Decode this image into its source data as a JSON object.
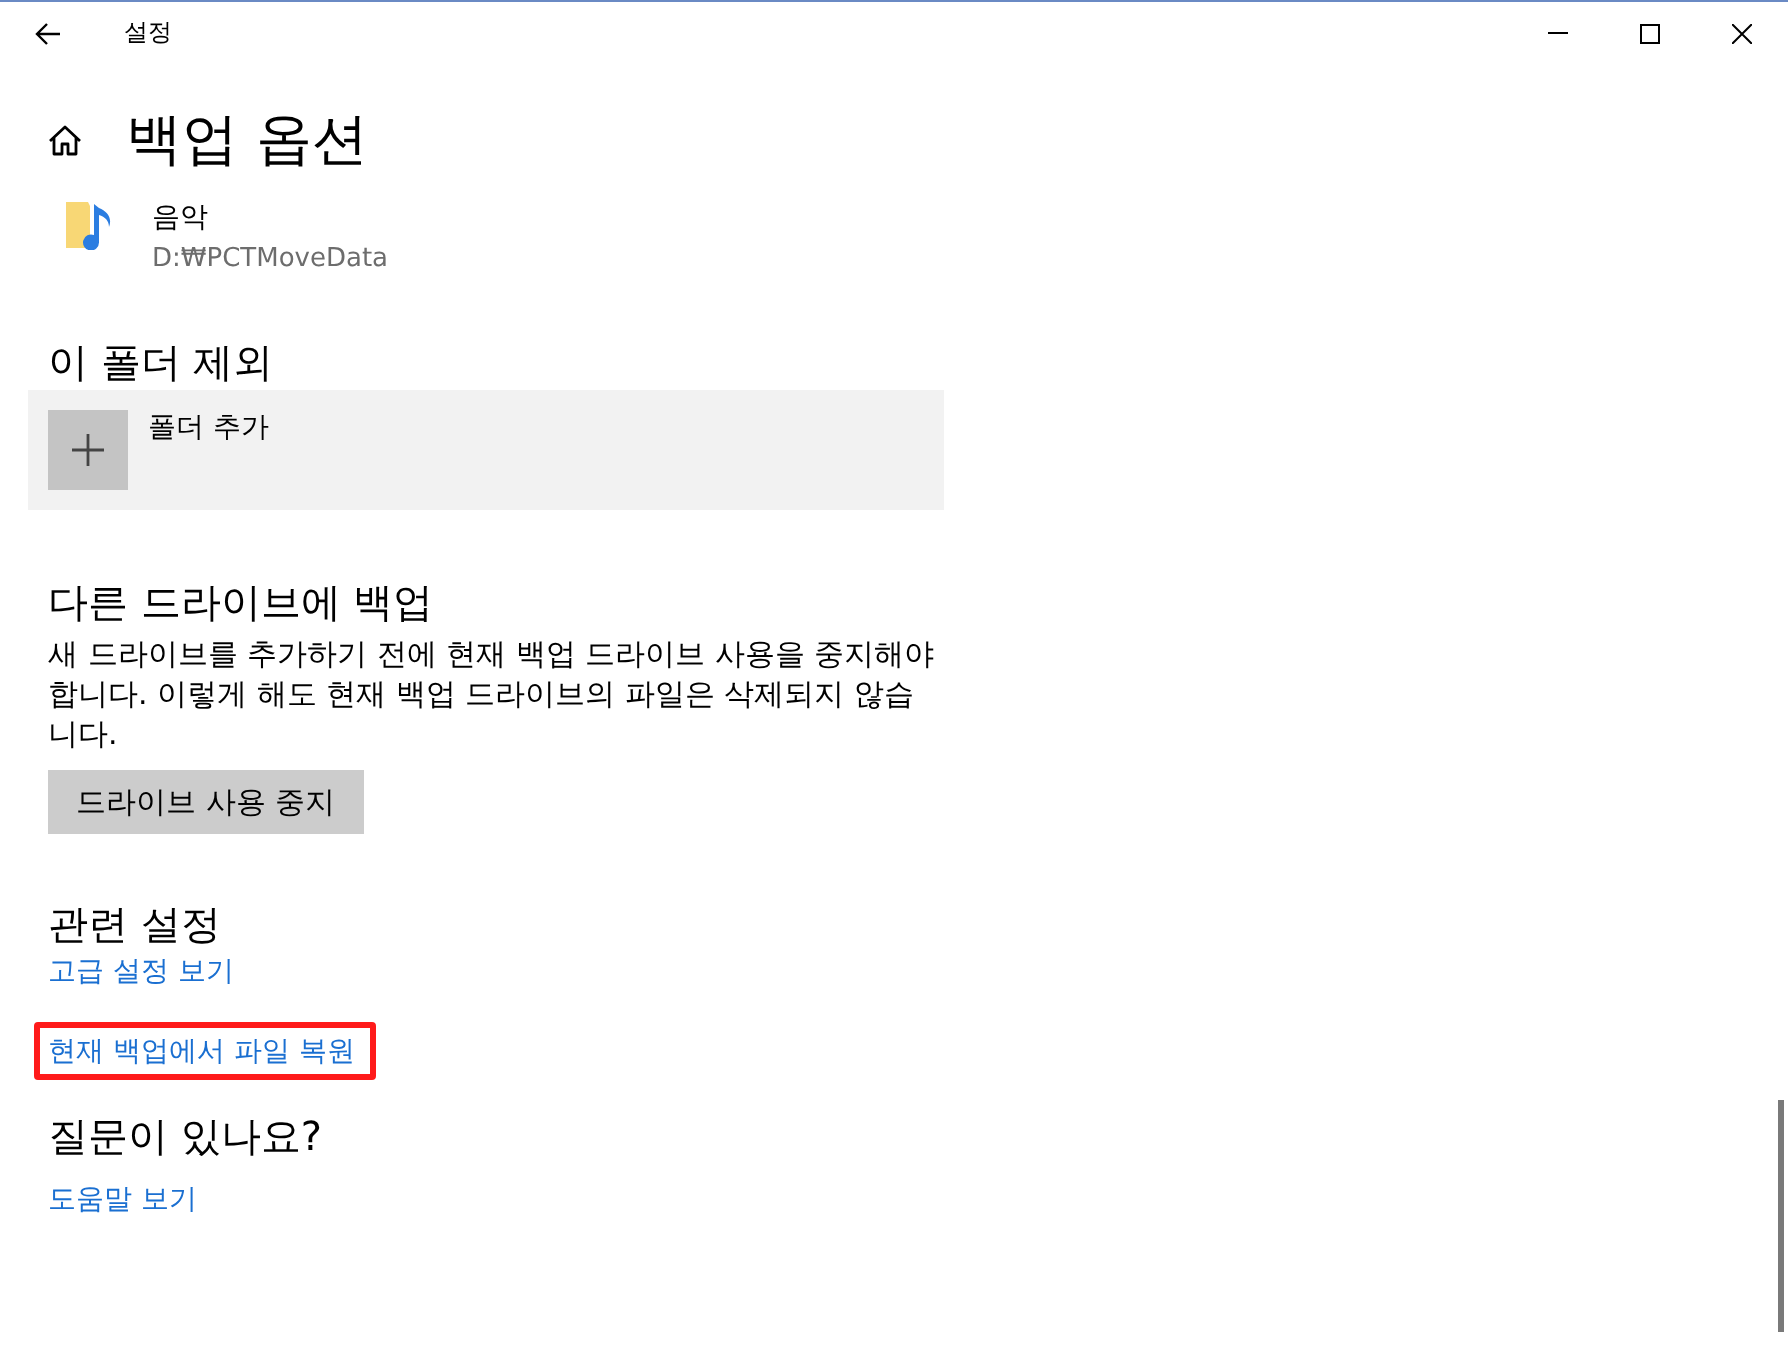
{
  "window": {
    "title": "설정"
  },
  "page": {
    "title": "백업 옵션"
  },
  "folders": [
    {
      "name": "음악",
      "path": "D:₩PCTMoveData"
    }
  ],
  "exclude": {
    "heading": "이 폴더 제외",
    "add_label": "폴더 추가"
  },
  "other_drive": {
    "heading": "다른 드라이브에 백업",
    "description": "새 드라이브를 추가하기 전에 현재 백업 드라이브 사용을 중지해야 합니다. 이렇게 해도 현재 백업 드라이브의 파일은 삭제되지 않습니다.",
    "button": "드라이브 사용 중지"
  },
  "related": {
    "heading": "관련 설정",
    "links": [
      {
        "label": "고급 설정 보기",
        "highlighted": false
      },
      {
        "label": "현재 백업에서 파일 복원",
        "highlighted": true
      }
    ]
  },
  "help": {
    "heading": "질문이 있나요?",
    "links": [
      {
        "label": "도움말 보기",
        "highlighted": false
      }
    ]
  }
}
